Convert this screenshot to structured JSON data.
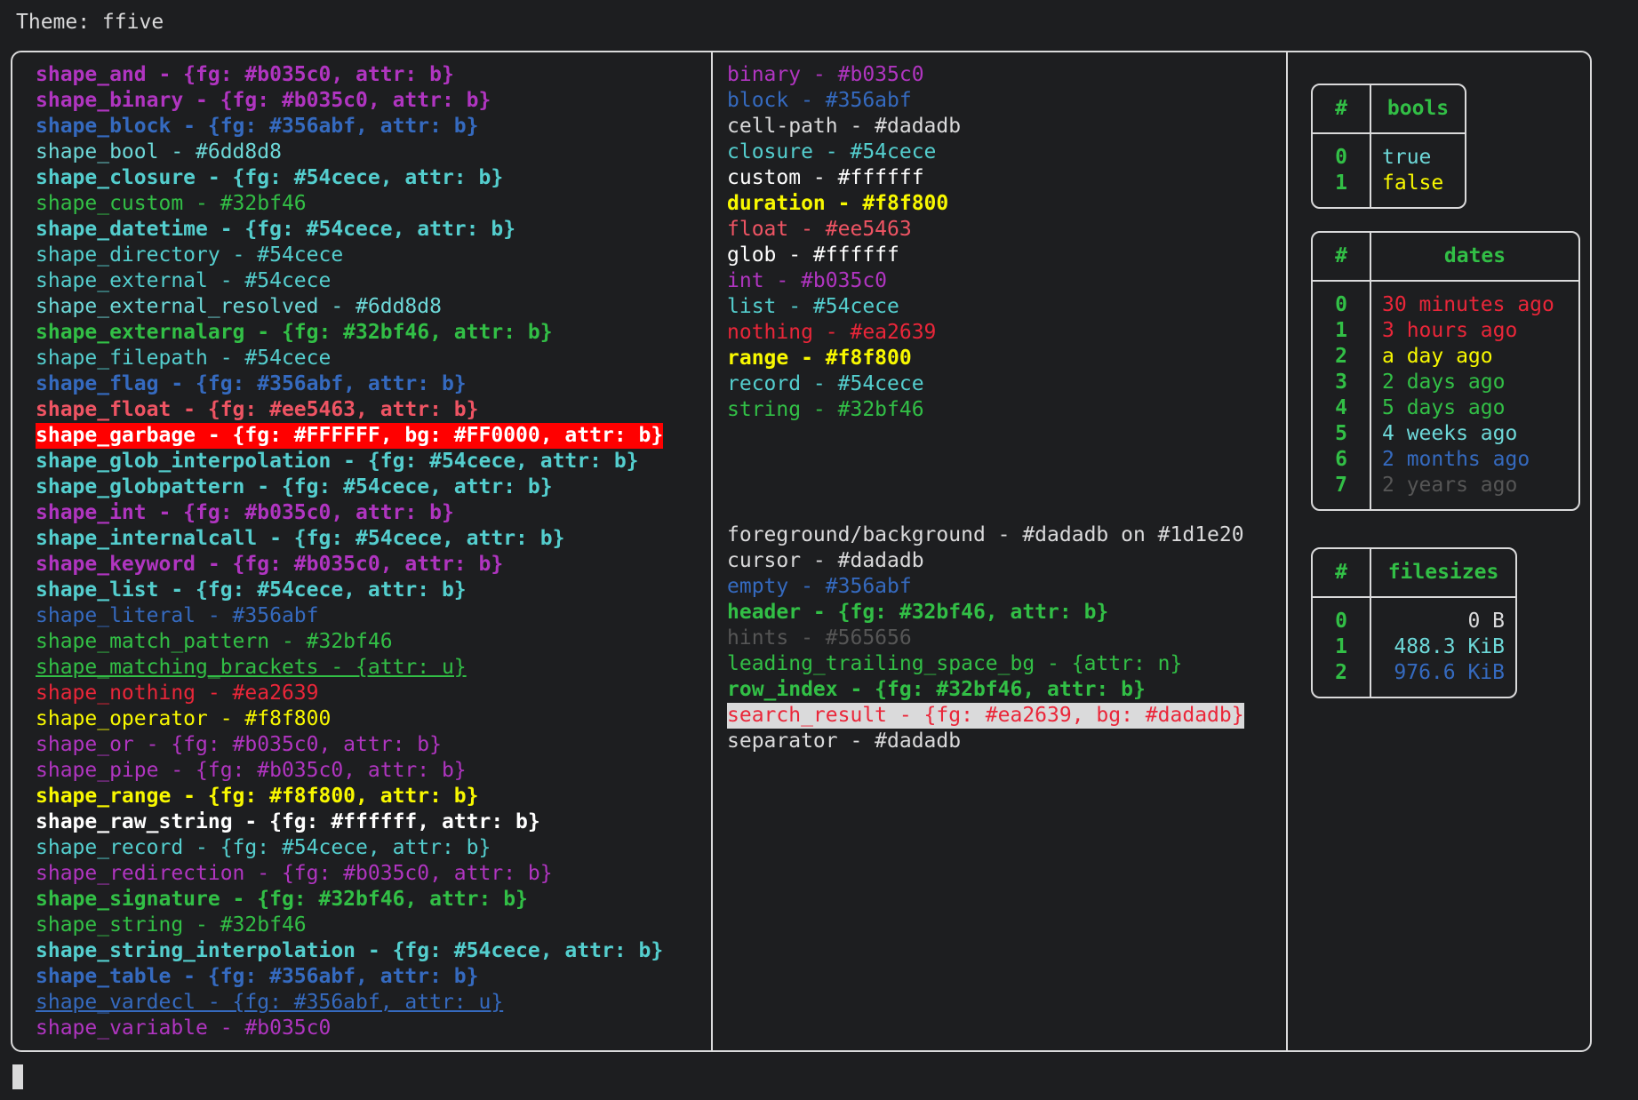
{
  "header": {
    "theme_label": "Theme: ffive"
  },
  "colors": {
    "background": "#1d1e20",
    "foreground": "#dadadb",
    "purple": "#b035c0",
    "blue": "#356abf",
    "cyan_light": "#6dd8d8",
    "cyan": "#54cece",
    "green": "#32bf46",
    "red": "#ee5463",
    "crimson": "#ea2639",
    "yellow": "#f8f800",
    "white": "#ffffff",
    "hint_grey": "#565656",
    "garbage_bg": "#FF0000",
    "garbage_fg": "#FFFFFF"
  },
  "shapes_column": [
    {
      "text": "shape_and - {fg: #b035c0, attr: b}",
      "cls": "c-purple b"
    },
    {
      "text": "shape_binary - {fg: #b035c0, attr: b}",
      "cls": "c-purple b"
    },
    {
      "text": "shape_block - {fg: #356abf, attr: b}",
      "cls": "c-blue b"
    },
    {
      "text": "shape_bool - #6dd8d8",
      "cls": "c-cyanlt"
    },
    {
      "text": "shape_closure - {fg: #54cece, attr: b}",
      "cls": "c-cyan b"
    },
    {
      "text": "shape_custom - #32bf46",
      "cls": "c-green"
    },
    {
      "text": "shape_datetime - {fg: #54cece, attr: b}",
      "cls": "c-cyan b"
    },
    {
      "text": "shape_directory - #54cece",
      "cls": "c-cyan"
    },
    {
      "text": "shape_external - #54cece",
      "cls": "c-cyan"
    },
    {
      "text": "shape_external_resolved - #6dd8d8",
      "cls": "c-cyanlt"
    },
    {
      "text": "shape_externalarg - {fg: #32bf46, attr: b}",
      "cls": "c-green b"
    },
    {
      "text": "shape_filepath - #54cece",
      "cls": "c-cyan"
    },
    {
      "text": "shape_flag - {fg: #356abf, attr: b}",
      "cls": "c-blue b"
    },
    {
      "text": "shape_float - {fg: #ee5463, attr: b}",
      "cls": "c-red b"
    },
    {
      "text": "shape_garbage - {fg: #FFFFFF, bg: #FF0000, attr: b}",
      "cls": "hl-garbage"
    },
    {
      "text": "shape_glob_interpolation - {fg: #54cece, attr: b}",
      "cls": "c-cyan b"
    },
    {
      "text": "shape_globpattern - {fg: #54cece, attr: b}",
      "cls": "c-cyan b"
    },
    {
      "text": "shape_int - {fg: #b035c0, attr: b}",
      "cls": "c-purple b"
    },
    {
      "text": "shape_internalcall - {fg: #54cece, attr: b}",
      "cls": "c-cyan b"
    },
    {
      "text": "shape_keyword - {fg: #b035c0, attr: b}",
      "cls": "c-purple b"
    },
    {
      "text": "shape_list - {fg: #54cece, attr: b}",
      "cls": "c-cyan b"
    },
    {
      "text": "shape_literal - #356abf",
      "cls": "c-blue"
    },
    {
      "text": "shape_match_pattern - #32bf46",
      "cls": "c-green"
    },
    {
      "text": "shape_matching_brackets - {attr: u}",
      "cls": "c-green u"
    },
    {
      "text": "shape_nothing - #ea2639",
      "cls": "c-red2"
    },
    {
      "text": "shape_operator - #f8f800",
      "cls": "c-yellow"
    },
    {
      "text": "shape_or - {fg: #b035c0, attr: b}",
      "cls": "c-purple"
    },
    {
      "text": "shape_pipe - {fg: #b035c0, attr: b}",
      "cls": "c-purple"
    },
    {
      "text": "shape_range - {fg: #f8f800, attr: b}",
      "cls": "c-yellow b"
    },
    {
      "text": "shape_raw_string - {fg: #ffffff, attr: b}",
      "cls": "c-white b"
    },
    {
      "text": "shape_record - {fg: #54cece, attr: b}",
      "cls": "c-cyan"
    },
    {
      "text": "shape_redirection - {fg: #b035c0, attr: b}",
      "cls": "c-purple"
    },
    {
      "text": "shape_signature - {fg: #32bf46, attr: b}",
      "cls": "c-green b"
    },
    {
      "text": "shape_string - #32bf46",
      "cls": "c-green"
    },
    {
      "text": "shape_string_interpolation - {fg: #54cece, attr: b}",
      "cls": "c-cyan b"
    },
    {
      "text": "shape_table - {fg: #356abf, attr: b}",
      "cls": "c-blue b"
    },
    {
      "text": "shape_vardecl - {fg: #356abf, attr: u}",
      "cls": "c-blue u"
    },
    {
      "text": "shape_variable - #b035c0",
      "cls": "c-purple"
    }
  ],
  "types_column": [
    {
      "text": "binary - #b035c0",
      "cls": "c-purple"
    },
    {
      "text": "block - #356abf",
      "cls": "c-blue"
    },
    {
      "text": "cell-path - #dadadb",
      "cls": "c-fg"
    },
    {
      "text": "closure - #54cece",
      "cls": "c-cyan"
    },
    {
      "text": "custom - #ffffff",
      "cls": "c-white"
    },
    {
      "text": "duration - #f8f800",
      "cls": "c-yellow b"
    },
    {
      "text": "float - #ee5463",
      "cls": "c-red"
    },
    {
      "text": "glob - #ffffff",
      "cls": "c-white"
    },
    {
      "text": "int - #b035c0",
      "cls": "c-purple"
    },
    {
      "text": "list - #54cece",
      "cls": "c-cyan"
    },
    {
      "text": "nothing - #ea2639",
      "cls": "c-red2"
    },
    {
      "text": "range - #f8f800",
      "cls": "c-yellow b"
    },
    {
      "text": "record - #54cece",
      "cls": "c-cyan"
    },
    {
      "text": "string - #32bf46",
      "cls": "c-green"
    }
  ],
  "ui_column": [
    {
      "text": "foreground/background - #dadadb on #1d1e20",
      "cls": "c-fg"
    },
    {
      "text": "cursor - #dadadb",
      "cls": "c-fg"
    },
    {
      "text": "empty - #356abf",
      "cls": "c-blue"
    },
    {
      "text": "header - {fg: #32bf46, attr: b}",
      "cls": "c-green b"
    },
    {
      "text": "hints - #565656",
      "cls": "c-grey"
    },
    {
      "text": "leading_trailing_space_bg - {attr: n}",
      "cls": "c-green"
    },
    {
      "text": "row_index - {fg: #32bf46, attr: b}",
      "cls": "c-green b"
    },
    {
      "text": "search_result - {fg: #ea2639, bg: #dadadb}",
      "cls": "hl-search"
    },
    {
      "text": "separator - #dadadb",
      "cls": "c-fg"
    }
  ],
  "tables": {
    "bools": {
      "index_header": "#",
      "value_header": "bools",
      "rows": [
        {
          "idx": "0",
          "value": "true",
          "cls": "c-cyanlt"
        },
        {
          "idx": "1",
          "value": "false",
          "cls": "c-yellow b"
        }
      ]
    },
    "dates": {
      "index_header": "#",
      "value_header": "dates",
      "rows": [
        {
          "idx": "0",
          "value": "30 minutes ago",
          "cls": "c-red2 b"
        },
        {
          "idx": "1",
          "value": "3 hours ago",
          "cls": "c-red2"
        },
        {
          "idx": "2",
          "value": "a day ago",
          "cls": "c-yellow b"
        },
        {
          "idx": "3",
          "value": "2 days ago",
          "cls": "c-green"
        },
        {
          "idx": "4",
          "value": "5 days ago",
          "cls": "c-green b"
        },
        {
          "idx": "5",
          "value": "4 weeks ago",
          "cls": "c-cyanlt"
        },
        {
          "idx": "6",
          "value": "2 months ago",
          "cls": "c-blue"
        },
        {
          "idx": "7",
          "value": "2 years ago",
          "cls": "c-grey"
        }
      ]
    },
    "filesizes": {
      "index_header": "#",
      "value_header": "filesizes",
      "rows": [
        {
          "idx": "0",
          "value": "0 B",
          "cls": "c-fg"
        },
        {
          "idx": "1",
          "value": "488.3 KiB",
          "cls": "c-cyanlt"
        },
        {
          "idx": "2",
          "value": "976.6 KiB",
          "cls": "c-blue"
        }
      ]
    }
  }
}
